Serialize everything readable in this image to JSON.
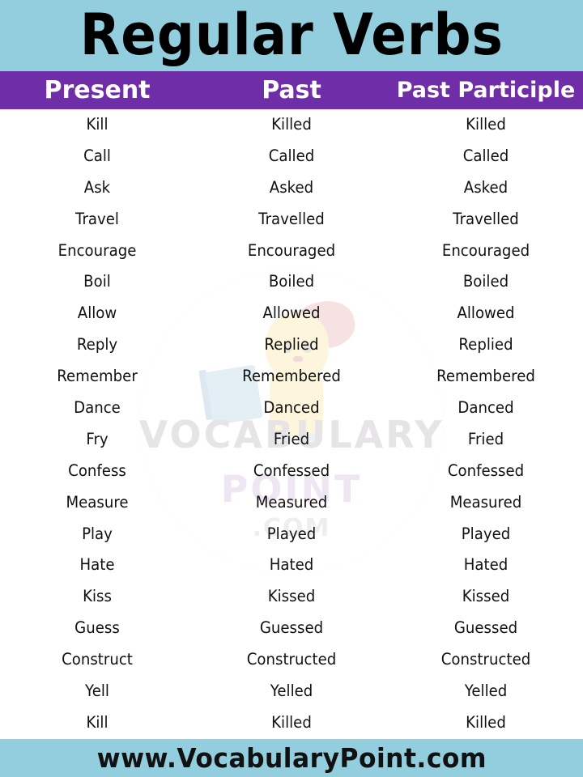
{
  "header": {
    "title": "Regular  Verbs",
    "title_bg": "#93cede",
    "column_header_bg": "#6f2da8",
    "columns": [
      "Present",
      "Past",
      "Past Participle"
    ]
  },
  "table": {
    "columns": [
      "Present",
      "Past",
      "Past Participle"
    ],
    "rows": [
      [
        "Kill",
        "Killed",
        "Killed"
      ],
      [
        "Call",
        "Called",
        "Called"
      ],
      [
        "Ask",
        "Asked",
        "Asked"
      ],
      [
        "Travel",
        "Travelled",
        "Travelled"
      ],
      [
        "Encourage",
        "Encouraged",
        "Encouraged"
      ],
      [
        "Boil",
        "Boiled",
        "Boiled"
      ],
      [
        "Allow",
        "Allowed",
        "Allowed"
      ],
      [
        "Reply",
        "Replied",
        "Replied"
      ],
      [
        "Remember",
        "Remembered",
        "Remembered"
      ],
      [
        "Dance",
        "Danced",
        "Danced"
      ],
      [
        "Fry",
        "Fried",
        "Fried"
      ],
      [
        "Confess",
        "Confessed",
        "Confessed"
      ],
      [
        "Measure",
        "Measured",
        "Measured"
      ],
      [
        "Play",
        "Played",
        "Played"
      ],
      [
        "Hate",
        "Hated",
        "Hated"
      ],
      [
        "Kiss",
        "Kissed",
        "Kissed"
      ],
      [
        "Guess",
        "Guessed",
        "Guessed"
      ],
      [
        "Construct",
        "Constructed",
        "Constructed"
      ],
      [
        "Yell",
        "Yelled",
        "Yelled"
      ],
      [
        "Kill",
        "Killed",
        "Killed"
      ]
    ]
  },
  "watermark": {
    "line1": "VOCABULARY",
    "line2": "POINT",
    "line3": ".COM",
    "ring_color": "#e2e2e2"
  },
  "footer": {
    "text": "www.VocabularyPoint.com",
    "bg": "#93cede"
  }
}
